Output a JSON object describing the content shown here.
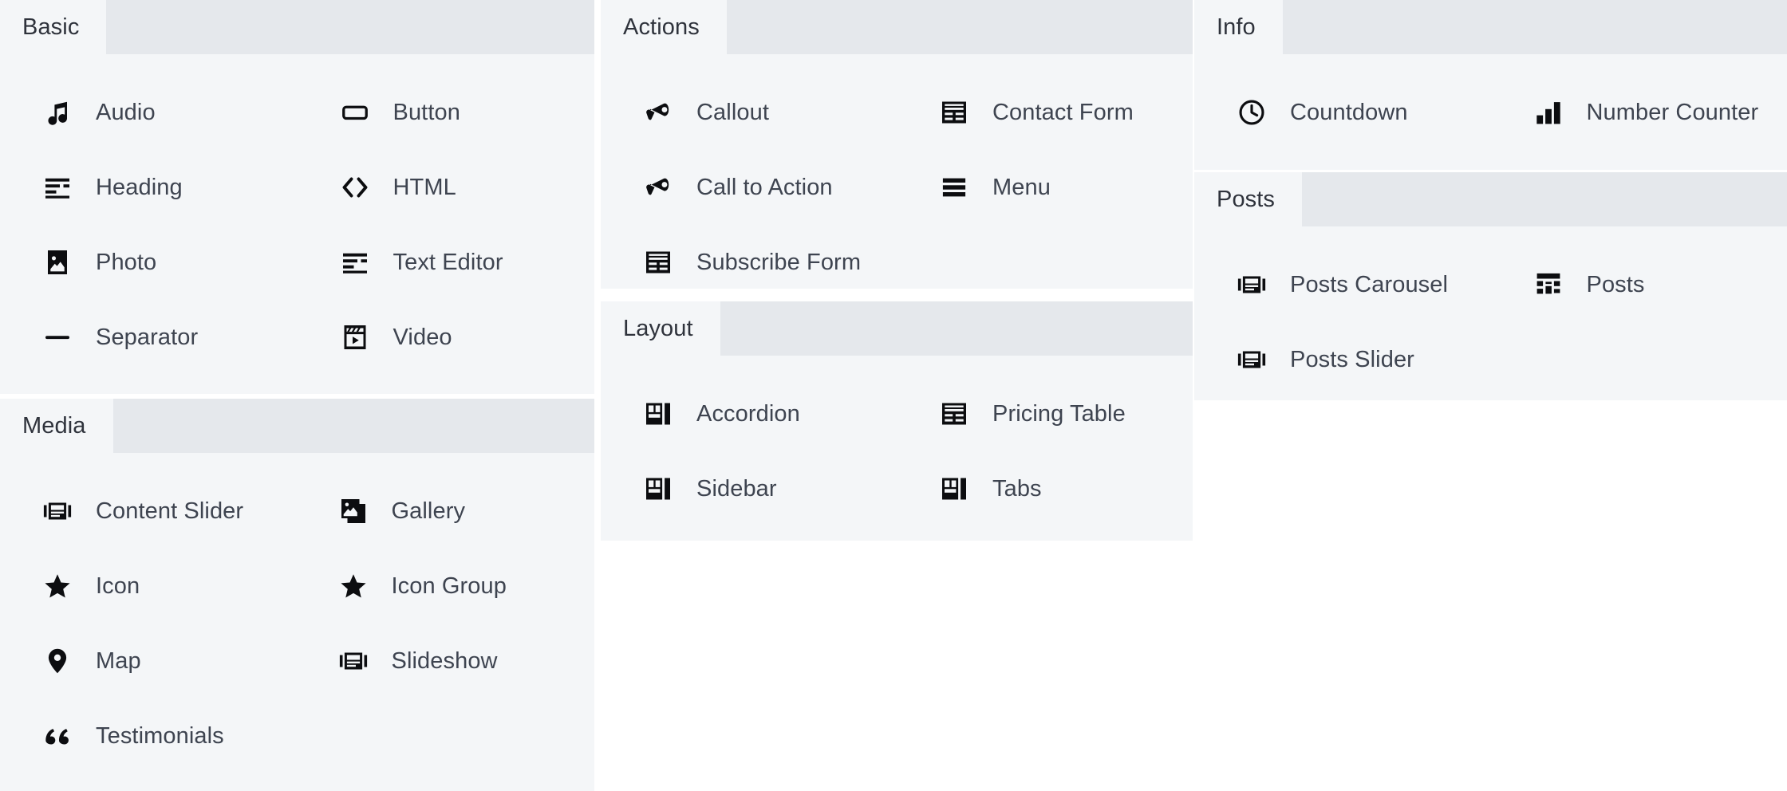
{
  "panels": [
    {
      "id": "basic",
      "title": "Basic",
      "items": [
        {
          "label": "Audio",
          "icon": "music-note-icon"
        },
        {
          "label": "Button",
          "icon": "button-icon"
        },
        {
          "label": "Heading",
          "icon": "heading-lines-icon"
        },
        {
          "label": "HTML",
          "icon": "code-brackets-icon"
        },
        {
          "label": "Photo",
          "icon": "photo-icon"
        },
        {
          "label": "Text Editor",
          "icon": "text-lines-icon"
        },
        {
          "label": "Separator",
          "icon": "separator-dash-icon"
        },
        {
          "label": "Video",
          "icon": "video-clapper-icon"
        }
      ]
    },
    {
      "id": "media",
      "title": "Media",
      "items": [
        {
          "label": "Content Slider",
          "icon": "slider-icon"
        },
        {
          "label": "Gallery",
          "icon": "gallery-stack-icon"
        },
        {
          "label": "Icon",
          "icon": "star-icon"
        },
        {
          "label": "Icon Group",
          "icon": "star-icon"
        },
        {
          "label": "Map",
          "icon": "map-pin-icon"
        },
        {
          "label": "Slideshow",
          "icon": "slider-icon"
        },
        {
          "label": "Testimonials",
          "icon": "quote-marks-icon"
        }
      ]
    },
    {
      "id": "actions",
      "title": "Actions",
      "items": [
        {
          "label": "Callout",
          "icon": "megaphone-icon"
        },
        {
          "label": "Contact Form",
          "icon": "form-table-icon"
        },
        {
          "label": "Call to Action",
          "icon": "megaphone-icon"
        },
        {
          "label": "Menu",
          "icon": "menu-bars-icon"
        },
        {
          "label": "Subscribe Form",
          "icon": "form-table-icon"
        }
      ]
    },
    {
      "id": "layout",
      "title": "Layout",
      "items": [
        {
          "label": "Accordion",
          "icon": "layout-blocks-icon"
        },
        {
          "label": "Pricing Table",
          "icon": "form-table-icon"
        },
        {
          "label": "Sidebar",
          "icon": "layout-blocks-icon"
        },
        {
          "label": "Tabs",
          "icon": "layout-blocks-icon"
        }
      ]
    },
    {
      "id": "info",
      "title": "Info",
      "items": [
        {
          "label": "Countdown",
          "icon": "clock-icon"
        },
        {
          "label": "Number Counter",
          "icon": "bar-chart-icon"
        }
      ]
    },
    {
      "id": "posts",
      "title": "Posts",
      "items": [
        {
          "label": "Posts Carousel",
          "icon": "slider-icon"
        },
        {
          "label": "Posts",
          "icon": "grid-layout-icon"
        },
        {
          "label": "Posts Slider",
          "icon": "slider-icon"
        }
      ]
    }
  ],
  "colors": {
    "panel_background": "#f4f6f8",
    "header_strip": "#e5e8ec",
    "tab_background": "#f4f6f8",
    "tab_text": "#2f333c",
    "item_text": "#3e4450",
    "icon": "#0c0d10",
    "page_background": "#ffffff"
  }
}
